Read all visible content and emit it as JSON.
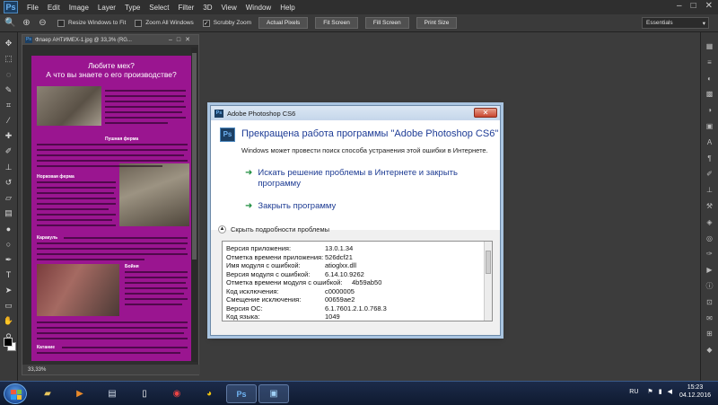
{
  "app": {
    "logo": "Ps",
    "menu": [
      "File",
      "Edit",
      "Image",
      "Layer",
      "Type",
      "Select",
      "Filter",
      "3D",
      "View",
      "Window",
      "Help"
    ],
    "window_controls": [
      "–",
      "□",
      "✕"
    ]
  },
  "options_bar": {
    "resize_windows": "Resize Windows to Fit",
    "zoom_all": "Zoom All Windows",
    "scrubby_zoom": "Scrubby Zoom",
    "scrubby_checked": "✓",
    "actual_pixels": "Actual Pixels",
    "fit_screen": "Fit Screen",
    "fill_screen": "Fill Screen",
    "print_size": "Print Size",
    "workspace": "Essentials"
  },
  "document": {
    "title": "Флаер АНТИМЕХ-1.jpg @ 33,3% (RG...",
    "zoom": "33,33%",
    "flyer_title_line1": "Любите мех?",
    "flyer_title_line2": "А что вы знаете о его производстве?",
    "label_fur_farm": "Пушная ферма",
    "label_mink_farm": "Норковая ферма",
    "label_karakul": "Каракуль",
    "label_slaughter": "Бойня",
    "label_katanie": "Катание"
  },
  "dialog": {
    "title": "Adobe Photoshop CS6",
    "heading": "Прекращена работа программы \"Adobe Photoshop CS6\"",
    "sub": "Windows может провести поиск способа устранения этой ошибки в Интернете.",
    "cmd_search": "Искать решение проблемы в Интернете и закрыть программу",
    "cmd_close": "Закрыть программу",
    "details_toggle": "Скрыть подробности проблемы",
    "details": [
      {
        "k": "Версия приложения:",
        "v": "13.0.1.34"
      },
      {
        "k": "Отметка времени приложения:",
        "v": "526dcf21"
      },
      {
        "k": "Имя модуля с ошибкой:",
        "v": "atioglxx.dll"
      },
      {
        "k": "Версия модуля с ошибкой:",
        "v": "6.14.10.9262"
      },
      {
        "k": "Отметка времени модуля с ошибкой:",
        "v": "4b59ab50"
      },
      {
        "k": "Код исключения:",
        "v": "c0000005"
      },
      {
        "k": "Смещение исключения:",
        "v": "00659ae2"
      },
      {
        "k": "Версия ОС:",
        "v": "6.1.7601.2.1.0.768.3"
      },
      {
        "k": "Код языка:",
        "v": "1049"
      }
    ]
  },
  "taskbar": {
    "language": "RU",
    "time": "15:23",
    "date": "04.12.2016"
  }
}
